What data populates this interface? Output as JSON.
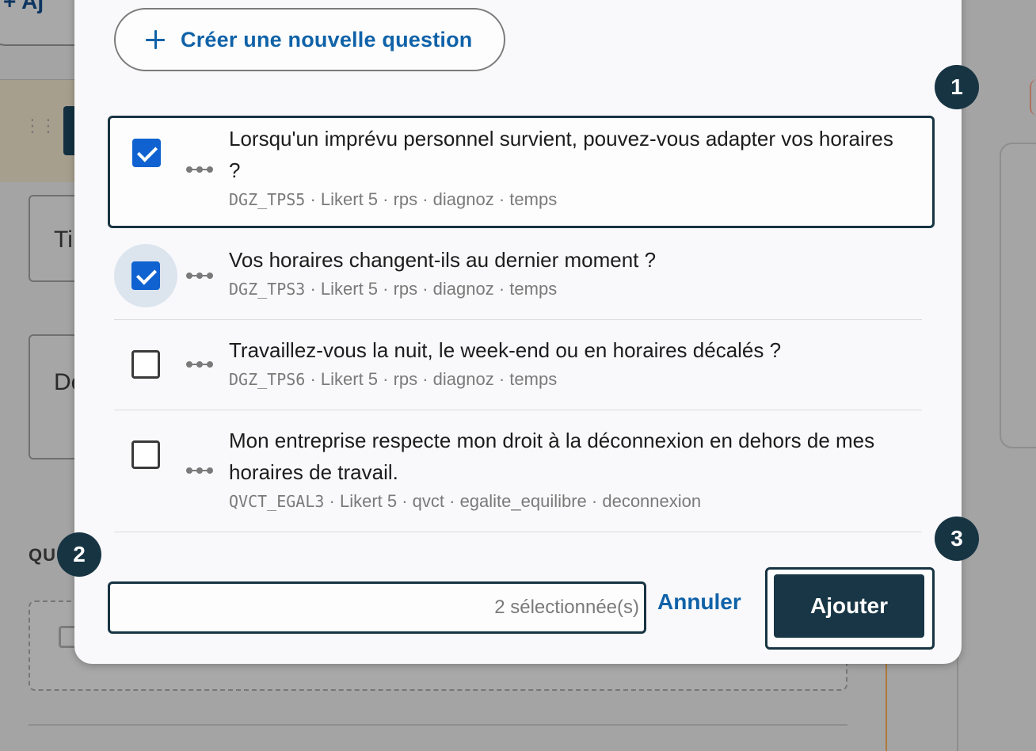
{
  "background": {
    "add_button_label": "Aj",
    "field1_text": "Ti",
    "field2_text": "De",
    "section_label": "QU"
  },
  "modal": {
    "create_question_label": "Créer une nouvelle question",
    "questions": [
      {
        "title": "Lorsqu'un imprévu personnel survient, pouvez-vous adapter vos horaires ?",
        "code": "DGZ_TPS5",
        "tags": " · Likert 5 · rps · diagnoz · temps",
        "checked": true
      },
      {
        "title": "Vos horaires changent-ils au dernier moment ?",
        "code": "DGZ_TPS3",
        "tags": " · Likert 5 · rps · diagnoz · temps",
        "checked": true
      },
      {
        "title": "Travaillez-vous la nuit, le week-end ou en horaires décalés ?",
        "code": "DGZ_TPS6",
        "tags": " · Likert 5 · rps · diagnoz · temps",
        "checked": false
      },
      {
        "title": "Mon entreprise respecte mon droit à la déconnexion en dehors de mes horaires de travail.",
        "code": "QVCT_EGAL3",
        "tags": " · Likert 5 · qvct · egalite_equilibre · deconnexion",
        "checked": false
      }
    ],
    "selection_count": "2 sélectionnée(s)",
    "cancel_label": "Annuler",
    "add_label": "Ajouter"
  },
  "callouts": [
    "1",
    "2",
    "3"
  ],
  "colors": {
    "accent": "#0f62a8",
    "checkbox": "#0f62d0",
    "primary_button": "#183645",
    "overlay": "#a4a4a4"
  }
}
